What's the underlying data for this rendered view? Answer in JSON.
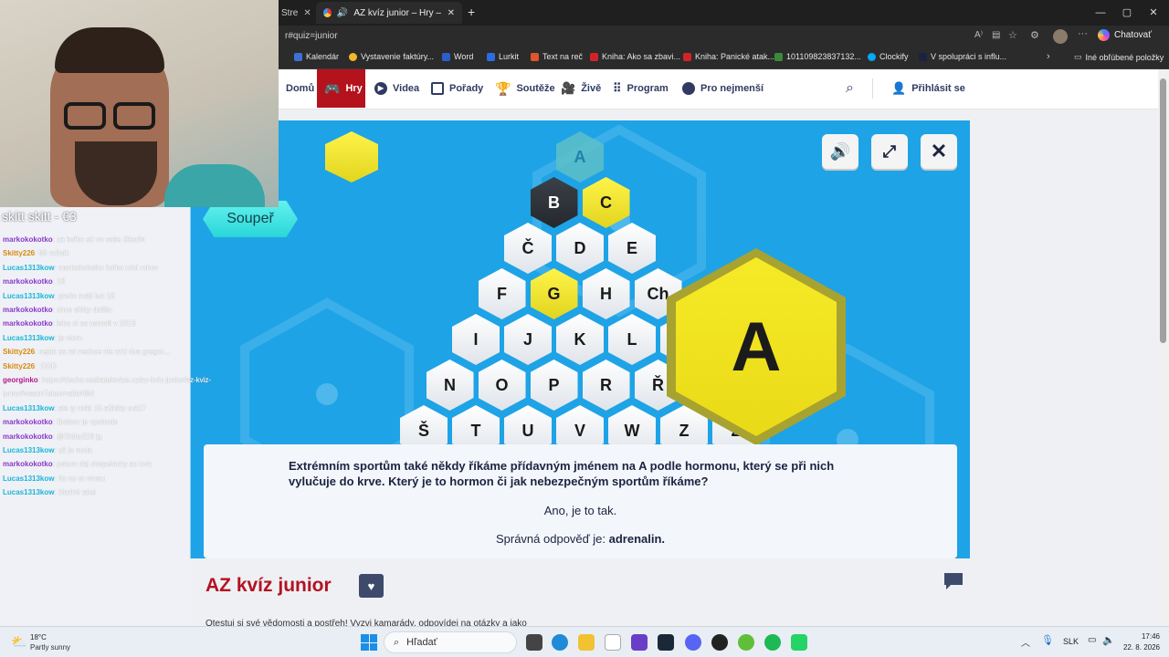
{
  "browser": {
    "tabs": [
      {
        "label": "Stre"
      },
      {
        "label": "AZ kvíz junior – Hry – Déčko –",
        "active": true
      }
    ],
    "url": "r#quiz=junior",
    "profile_button": "Chatovať",
    "favorites": [
      {
        "label": "Kalendár",
        "icon": "calendar-icon"
      },
      {
        "label": "Vystavenie faktúry...",
        "icon": "coin-icon"
      },
      {
        "label": "Word",
        "icon": "word-icon"
      },
      {
        "label": "Lurkit",
        "icon": "lurkit-icon"
      },
      {
        "label": "Text na reč",
        "icon": "speech-icon"
      },
      {
        "label": "Kniha: Ako sa zbavi...",
        "icon": "book-icon"
      },
      {
        "label": "Kniha: Panické atak...",
        "icon": "book-icon"
      },
      {
        "label": "101109823837132...",
        "icon": "page-icon"
      },
      {
        "label": "Clockify",
        "icon": "clockify-icon"
      },
      {
        "label": "V spolupráci s influ...",
        "icon": "page-icon"
      }
    ],
    "other_favorites": "Iné obľúbené položky"
  },
  "site_nav": {
    "items": [
      {
        "label": "Domů",
        "icon": "home-icon"
      },
      {
        "label": "Hry",
        "icon": "gamepad-icon",
        "active": true
      },
      {
        "label": "Videa",
        "icon": "play-icon"
      },
      {
        "label": "Pořady",
        "icon": "tv-icon"
      },
      {
        "label": "Soutěže",
        "icon": "trophy-icon"
      },
      {
        "label": "Živě",
        "icon": "camera-icon"
      },
      {
        "label": "Program",
        "icon": "grid-icon"
      },
      {
        "label": "Pro nejmenší",
        "icon": "bear-icon"
      }
    ],
    "login": "Přihlásit se"
  },
  "game": {
    "opponent_label": "Soupeř",
    "selected_letter": "A",
    "hex_rows": [
      [
        {
          "l": "A",
          "s": "teal"
        }
      ],
      [
        {
          "l": "B",
          "s": "dark"
        },
        {
          "l": "C",
          "s": "yellow"
        }
      ],
      [
        {
          "l": "Č",
          "s": "white"
        },
        {
          "l": "D",
          "s": "white"
        },
        {
          "l": "E",
          "s": "white"
        }
      ],
      [
        {
          "l": "F",
          "s": "white"
        },
        {
          "l": "G",
          "s": "yellow"
        },
        {
          "l": "H",
          "s": "white"
        },
        {
          "l": "Ch",
          "s": "white"
        }
      ],
      [
        {
          "l": "I",
          "s": "white"
        },
        {
          "l": "J",
          "s": "white"
        },
        {
          "l": "K",
          "s": "white"
        },
        {
          "l": "L",
          "s": "white"
        },
        {
          "l": "",
          "s": "white"
        }
      ],
      [
        {
          "l": "N",
          "s": "white"
        },
        {
          "l": "O",
          "s": "white"
        },
        {
          "l": "P",
          "s": "white"
        },
        {
          "l": "R",
          "s": "white"
        },
        {
          "l": "Ř",
          "s": "white"
        },
        {
          "l": "",
          "s": "white"
        }
      ],
      [
        {
          "l": "Š",
          "s": "white"
        },
        {
          "l": "T",
          "s": "white"
        },
        {
          "l": "U",
          "s": "white"
        },
        {
          "l": "V",
          "s": "white"
        },
        {
          "l": "W",
          "s": "white"
        },
        {
          "l": "Z",
          "s": "white"
        },
        {
          "l": "Ž",
          "s": "white"
        }
      ]
    ],
    "question": "Extrémním sportům také někdy říkáme přídavným jménem na A podle hormonu, který se při nich vylučuje do krve. Který je to hormon či jak nebezpečným sportům říkáme?",
    "feedback": "Ano, je to tak.",
    "correct_prefix": "Správná odpověď je:",
    "correct_answer": "adrenalin."
  },
  "page": {
    "title": "AZ kvíz junior",
    "intro": "Otestuj si své vědomosti a postřeh! Vyzvi kamarády, odpovídej na otázky a jako"
  },
  "stream": {
    "chat_title": "skitt skitt - €3",
    "chat": [
      {
        "user": "markokokotko",
        "msg": "za koľko sú vo vaše Skodin",
        "color": "#8a39c9"
      },
      {
        "user": "Skitty226",
        "msg": "98 ročník",
        "color": "#d88a10"
      },
      {
        "user": "Lucas1313kow",
        "msg": "markokokotko koľko robí rokov",
        "color": "#19b6d6"
      },
      {
        "user": "markokokotko",
        "msg": "18",
        "color": "#8a39c9"
      },
      {
        "user": "Lucas1313kow",
        "msg": "prečo máš len 18",
        "color": "#19b6d6"
      },
      {
        "user": "markokokotko",
        "msg": "chce skitty dalšiu",
        "color": "#8a39c9"
      },
      {
        "user": "markokokotko",
        "msg": "lebo si sa narodil v 2013",
        "color": "#8a39c9"
      },
      {
        "user": "Lucas1313kow",
        "msg": "je vtom",
        "color": "#19b6d6"
      },
      {
        "user": "Skitty226",
        "msg": "nejak sa mi nechce ale ta'd dva gregor....",
        "color": "#d88a10"
      },
      {
        "user": "Skitty226",
        "msg": ":DDD",
        "color": "#d88a10"
      },
      {
        "user": "georginko",
        "msg": "https://decko.ceskatelevize.cz/az-kviz-junior/az-kviz-",
        "color": "#b0198a"
      },
      {
        "user": "",
        "msg": "junior#watchToken=a8d48fd",
        "color": "#b0198a"
      },
      {
        "user": "Lucas1313kow",
        "msg": "ale ty máš 18 aSkitty má27",
        "color": "#19b6d6"
      },
      {
        "user": "markokokotko",
        "msg": "Srabov je vpohode",
        "color": "#8a39c9"
      },
      {
        "user": "markokokotko",
        "msg": "@Skitty226 jg",
        "color": "#8a39c9"
      },
      {
        "user": "Lucas1313kow",
        "msg": "už je nuda",
        "color": "#19b6d6"
      },
      {
        "user": "markokokotko",
        "msg": "potom daj dospelacky az kviz",
        "color": "#8a39c9"
      },
      {
        "user": "Lucas1313kow",
        "msg": "čo no to mnau",
        "color": "#19b6d6"
      },
      {
        "user": "Lucas1313kow",
        "msg": "žiadné také",
        "color": "#19b6d6"
      }
    ]
  },
  "taskbar": {
    "weather_temp": "18°C",
    "weather_desc": "Partly sunny",
    "search_label": "Hľadať",
    "lang": "SLK",
    "time": "17:46",
    "date": "22. 8. 2026"
  },
  "colors": {
    "brand_red": "#b4121d",
    "game_blue": "#1ea3e6",
    "hex_yellow": "#f1e22a",
    "nav_text": "#2f3b62"
  }
}
